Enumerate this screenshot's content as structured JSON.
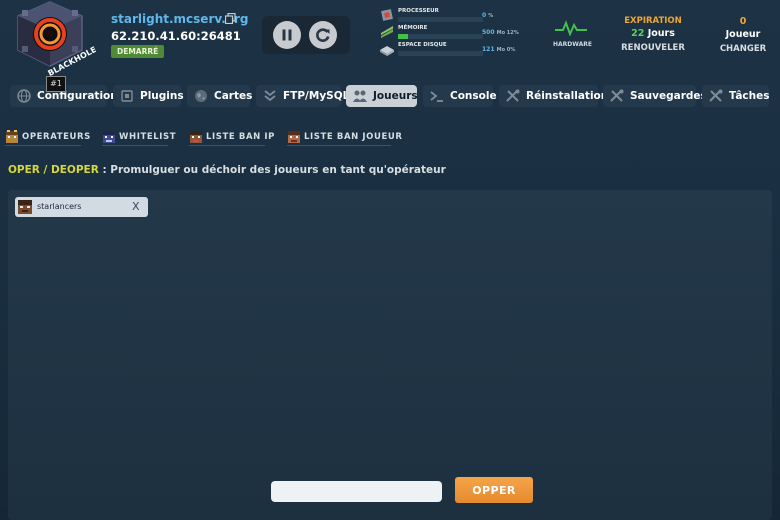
{
  "server": {
    "logo_text": "BLACKHOLE",
    "rank": "#1",
    "name": "starlight.mcserv.org",
    "ip": "62.210.41.60:26481",
    "status": "DEMARRÉ"
  },
  "resources": [
    {
      "label": "PROCESSEUR",
      "value": "0",
      "unit": "%",
      "fill": 0
    },
    {
      "label": "MÉMOIRE",
      "value": "500",
      "unit": "Mo 12%",
      "fill": 0.12
    },
    {
      "label": "ESPACE DISQUE",
      "value": "121",
      "unit": "Mo 0%",
      "fill": 0
    }
  ],
  "hardware_label": "HARDWARE",
  "expiration": {
    "title": "EXPIRATION",
    "days_value": "22",
    "days_unit": "Jours",
    "renew_label": "RENOUVELER"
  },
  "players": {
    "count": "0",
    "label": "Joueur",
    "change_label": "CHANGER"
  },
  "tabs": [
    {
      "label": "Configuration",
      "active": false
    },
    {
      "label": "Plugins",
      "active": false
    },
    {
      "label": "Cartes",
      "active": false
    },
    {
      "label": "FTP/MySQL",
      "active": false
    },
    {
      "label": "Joueurs",
      "active": true
    },
    {
      "label": "Console",
      "active": false
    },
    {
      "label": "Réinstallation",
      "active": false
    },
    {
      "label": "Sauvegardes",
      "active": false
    },
    {
      "label": "Tâches",
      "active": false
    }
  ],
  "subtabs": [
    {
      "label": "OPERATEURS"
    },
    {
      "label": "WHITELIST"
    },
    {
      "label": "LISTE BAN IP"
    },
    {
      "label": "LISTE BAN JOUEUR"
    }
  ],
  "section": {
    "highlight": "OPER / DEOPER",
    "description": ": Promulguer ou déchoir des joueurs en tant qu'opérateur"
  },
  "operators": [
    {
      "name": "starlancers",
      "remove_label": "X"
    }
  ],
  "form": {
    "input_value": "",
    "input_placeholder": "",
    "submit_label": "OPPER"
  },
  "colors": {
    "accent_blue": "#5fb7ea",
    "accent_orange": "#f0a531",
    "highlight_yellow": "#d6d83a",
    "status_green": "#4f8a34"
  }
}
